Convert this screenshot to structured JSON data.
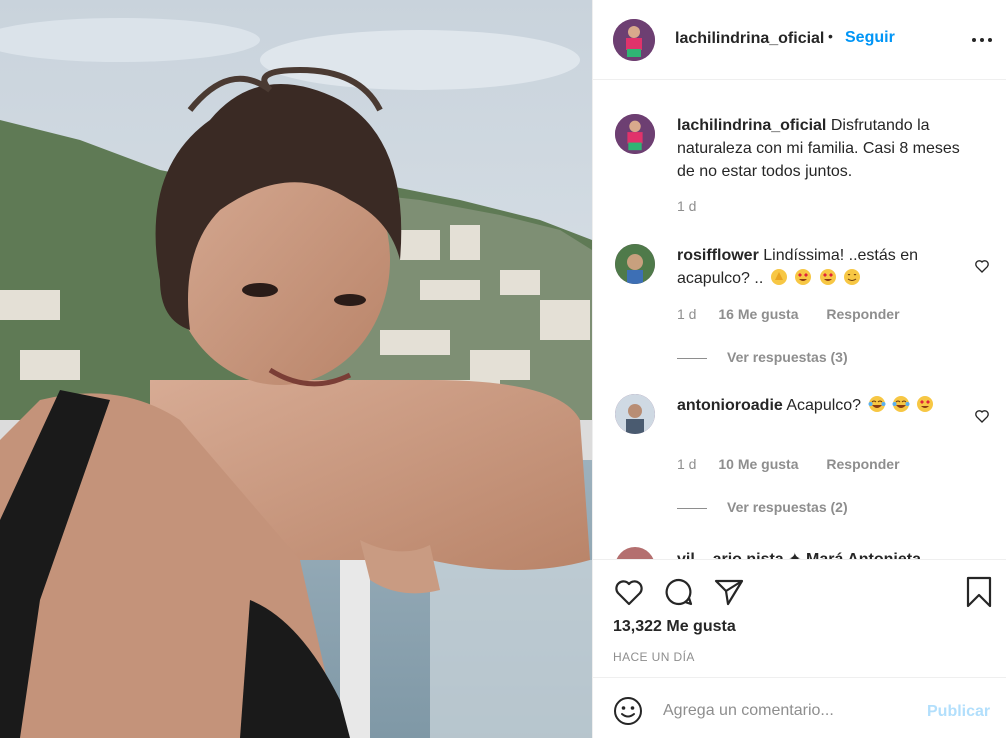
{
  "post": {
    "photo_alt": "",
    "author": {
      "username": "lachilindrina_oficial",
      "avatar_icon": "profile-avatar",
      "follow_label": "Seguir",
      "separator": "•"
    },
    "caption": {
      "username": "lachilindrina_oficial",
      "text": "Disfrutando la naturaleza con mi familia. Casi 8 meses de no estar todos juntos.",
      "time": "1 d"
    },
    "comments": [
      {
        "username": "rosifflower",
        "text": "Lindíssima! ..estás en acapulco? ..",
        "emojis": [
          "clapping-hands-emoji",
          "heart-eyes-emoji",
          "heart-eyes-emoji",
          "smiling-face-emoji"
        ],
        "time": "1 d",
        "likes": "16 Me gusta",
        "reply_label": "Responder",
        "view_replies": "Ver respuestas (3)"
      },
      {
        "username": "antonioroadie",
        "text": "Acapulco?",
        "emojis": [
          "tears-of-joy-emoji",
          "tears-of-joy-emoji",
          "heart-eyes-emoji"
        ],
        "time": "1 d",
        "likes": "10 Me gusta",
        "reply_label": "Responder",
        "view_replies": "Ver respuestas (2)"
      }
    ],
    "partial_comment": "vil... ario.nista ✦ Mará Antonieta",
    "likes_count": "13,322 Me gusta",
    "time_ago": "HACE UN DÍA",
    "composer": {
      "placeholder": "Agrega un comentario...",
      "publish_label": "Publicar"
    }
  },
  "colors": {
    "accent": "#0095f6",
    "publish_disabled": "#b2dffc",
    "muted": "#8e8e8e",
    "text": "#262626",
    "border": "#efefef"
  },
  "icons": {
    "like": "heart-icon",
    "comment": "comment-icon",
    "share": "paper-plane-icon",
    "save": "bookmark-icon",
    "more": "more-options-icon",
    "emoji": "smiley-icon"
  }
}
